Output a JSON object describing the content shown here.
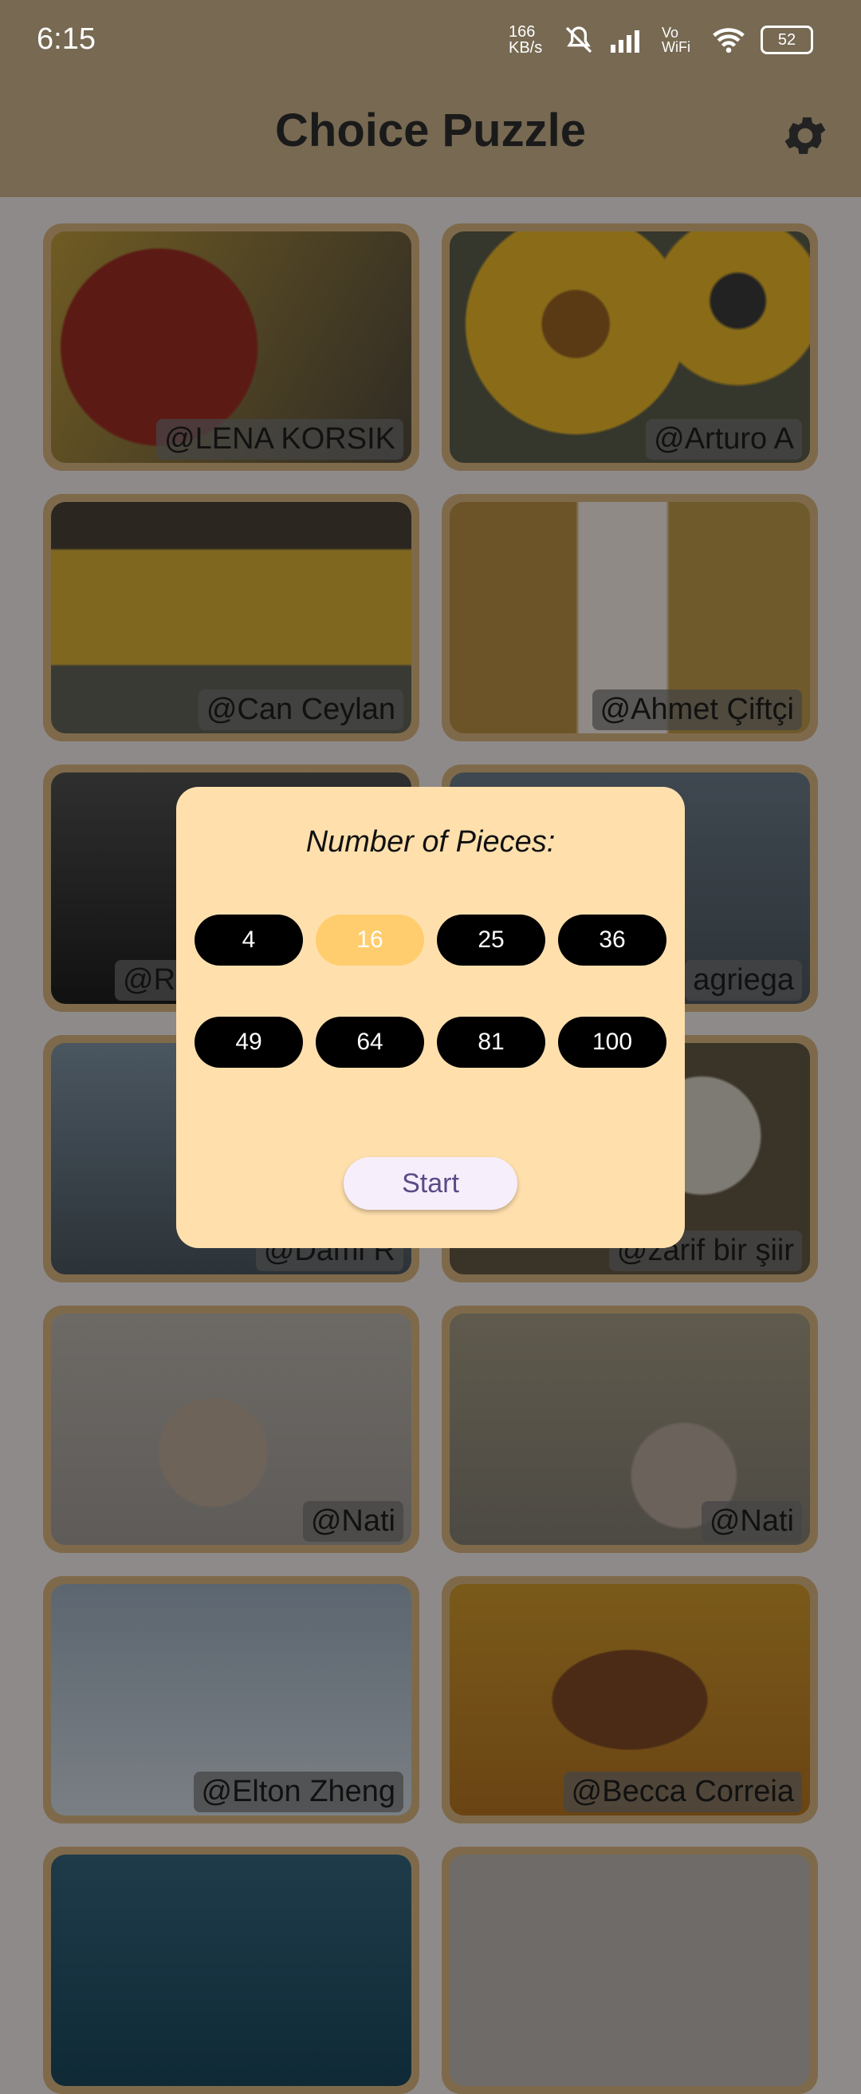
{
  "status_bar": {
    "time": "6:15",
    "network_speed": "166 KB/s",
    "battery": "52"
  },
  "app_bar": {
    "title": "Choice Puzzle",
    "settings_icon": "gear-icon"
  },
  "puzzle_cards": [
    {
      "credit": "@LENA  KORSIK"
    },
    {
      "credit": "@Arturo  A"
    },
    {
      "credit": "@Can Ceylan"
    },
    {
      "credit": "@Ahmet Çiftçi"
    },
    {
      "credit": "@R"
    },
    {
      "credit": "agriega"
    },
    {
      "credit": "@Dami R"
    },
    {
      "credit": "@zarif bir şiir"
    },
    {
      "credit": "@Nati"
    },
    {
      "credit": "@Nati"
    },
    {
      "credit": "@Elton Zheng"
    },
    {
      "credit": "@Becca Correia"
    },
    {
      "credit": ""
    },
    {
      "credit": ""
    }
  ],
  "dialog": {
    "title": "Number of Pieces:",
    "options": [
      "4",
      "16",
      "25",
      "36",
      "49",
      "64",
      "81",
      "100"
    ],
    "selected": "16",
    "start_label": "Start"
  },
  "colors": {
    "app_bar": "#776952",
    "dialog_bg": "#ffe0ad",
    "chip": "#000000",
    "chip_selected": "#ffcd6e",
    "start_text": "#5b4a86"
  }
}
